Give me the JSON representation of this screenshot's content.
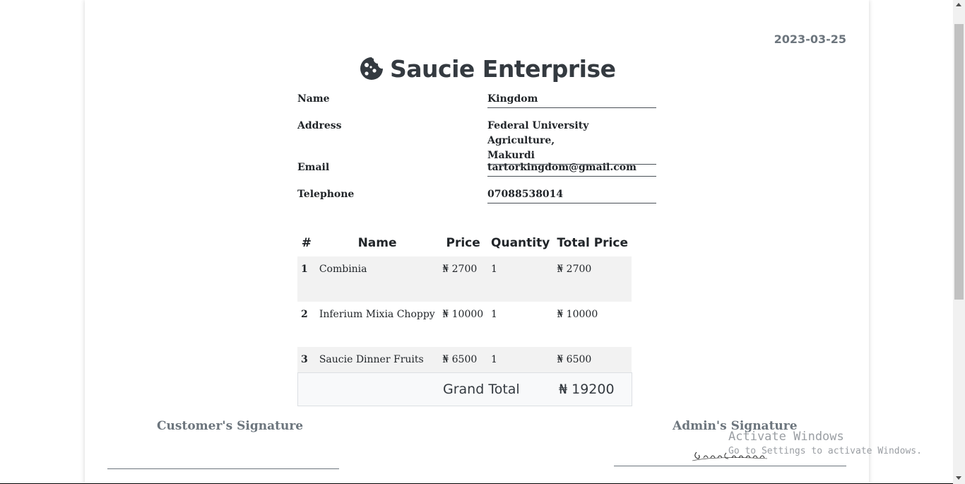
{
  "header": {
    "date": "2023-03-25",
    "company_name": "Saucie Enterprise",
    "icon": "cookie-icon"
  },
  "customer": {
    "name_label": "Name",
    "name_value": "Kingdom",
    "address_label": "Address",
    "address_line1": "Federal University Agriculture,",
    "address_line2": "Makurdi",
    "email_label": "Email",
    "email_value": "tartorkingdom@gmail.com",
    "telephone_label": "Telephone",
    "telephone_value": "07088538014"
  },
  "items_table": {
    "columns": [
      "#",
      "Name",
      "Price",
      "Quantity",
      "Total Price"
    ],
    "rows": [
      {
        "index": "1",
        "name": "Combinia",
        "price": "₦ 2700",
        "quantity": "1",
        "total": "₦ 2700"
      },
      {
        "index": "2",
        "name": "Inferium Mixia Choppy",
        "price": "₦ 10000",
        "quantity": "1",
        "total": "₦ 10000"
      },
      {
        "index": "3",
        "name": "Saucie Dinner Fruits",
        "price": "₦ 6500",
        "quantity": "1",
        "total": "₦ 6500"
      }
    ],
    "grand_total_label": "Grand Total",
    "grand_total_value": "₦ 19200"
  },
  "signatures": {
    "customer_label": "Customer's Signature",
    "admin_label": "Admin's Signature",
    "admin_signature_text": "SaucieEnterprise"
  },
  "watermark": {
    "title": "Activate Windows",
    "subtitle": "Go to Settings to activate Windows."
  }
}
